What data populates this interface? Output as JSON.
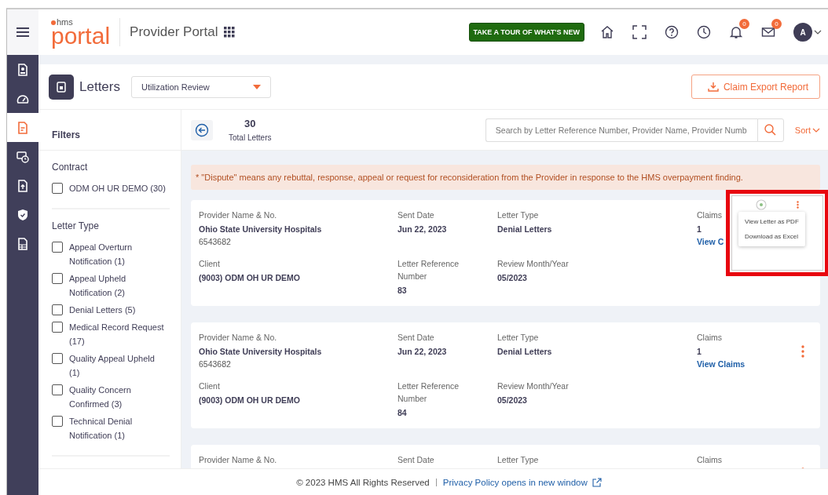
{
  "header": {
    "logo_small": "hms",
    "logo": "portal",
    "title": "Provider Portal",
    "tour_button": "TAKE A TOUR OF WHAT'S NEW",
    "notifications_count": "0",
    "messages_count": "0",
    "avatar": "A"
  },
  "nav": [
    {
      "kind": "profile",
      "selected": false
    },
    {
      "kind": "gauge",
      "selected": false
    },
    {
      "kind": "document",
      "selected": true
    },
    {
      "kind": "billing",
      "selected": false
    },
    {
      "kind": "upload",
      "selected": false
    },
    {
      "kind": "shield",
      "selected": false
    },
    {
      "kind": "report",
      "selected": false
    }
  ],
  "page": {
    "title": "Letters",
    "program": "Utilization Review",
    "export_button": "Claim Export Report"
  },
  "filters": {
    "title": "Filters",
    "groups": [
      {
        "title": "Contract",
        "options": [
          {
            "label": "ODM OH UR DEMO (30)",
            "checked": false
          }
        ]
      },
      {
        "title": "Letter Type",
        "options": [
          {
            "label": "Appeal Overturn Notification (1)",
            "checked": false
          },
          {
            "label": "Appeal Upheld Notification (2)",
            "checked": false
          },
          {
            "label": "Denial Letters (5)",
            "checked": false
          },
          {
            "label": "Medical Record Request (17)",
            "checked": false
          },
          {
            "label": "Quality Appeal Upheld (1)",
            "checked": false
          },
          {
            "label": "Quality Concern Confirmed (3)",
            "checked": false
          },
          {
            "label": "Technical Denial Notification (1)",
            "checked": false
          }
        ]
      }
    ]
  },
  "list": {
    "count": "30",
    "count_label": "Total Letters",
    "search_placeholder": "Search by Letter Reference Number, Provider Name, Provider Numb",
    "sort": "Sort",
    "notice": "* \"Dispute\" means any rebuttal, response, appeal or request for reconsideration from the Provider in response to the HMS overpayment finding.",
    "cards": [
      {
        "provider_label": "Provider Name & No.",
        "provider": "Ohio State University Hospitals",
        "provider_no": "6543682",
        "sent_label": "Sent Date",
        "sent": "Jun 22, 2023",
        "type_label": "Letter Type",
        "type": "Denial Letters",
        "claims_label": "Claims",
        "claims": "1",
        "claims_link": "View C",
        "client_label": "Client",
        "client": "(9003) ODM OH UR DEMO",
        "ref_label": "Letter Reference Number",
        "ref": "83",
        "review_label": "Review Month/Year",
        "review": "05/2023"
      },
      {
        "provider_label": "Provider Name & No.",
        "provider": "Ohio State University Hospitals",
        "provider_no": "6543682",
        "sent_label": "Sent Date",
        "sent": "Jun 22, 2023",
        "type_label": "Letter Type",
        "type": "Denial Letters",
        "claims_label": "Claims",
        "claims": "1",
        "claims_link": "View Claims",
        "client_label": "Client",
        "client": "(9003) ODM OH UR DEMO",
        "ref_label": "Letter Reference Number",
        "ref": "84",
        "review_label": "Review Month/Year",
        "review": "05/2023"
      },
      {
        "provider_label": "Provider Name & No.",
        "sent_label": "Sent Date",
        "type_label": "Letter Type",
        "claims_label": "Claims"
      }
    ]
  },
  "callout": {
    "menu": [
      "View Letter as PDF",
      "Download as Excel"
    ]
  },
  "footer": {
    "copyright": "© 2023 HMS All Rights Reserved",
    "link": "Privacy Policy opens in new window"
  }
}
